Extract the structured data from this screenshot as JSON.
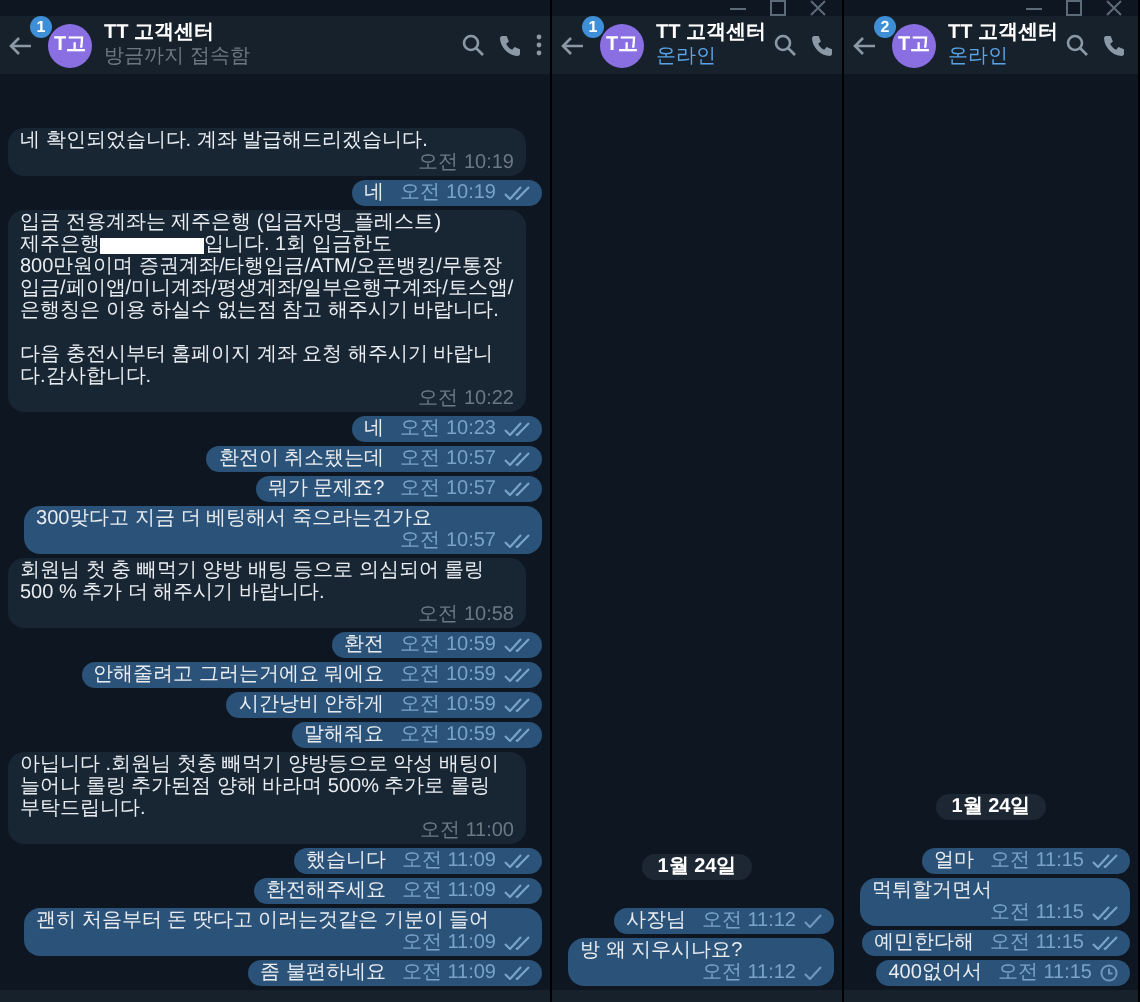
{
  "panes": [
    {
      "window_controls": false,
      "header": {
        "badge": "1",
        "avatar": "T고",
        "title": "TT 고객센터",
        "subtitle": "방금까지 접속함",
        "online": false
      },
      "messages": [
        {
          "kind": "message",
          "outgoing": false,
          "text": "네 확인되었습니다. 계좌 발급해드리겠습니다.",
          "time": "오전 10:19"
        },
        {
          "kind": "message",
          "outgoing": true,
          "text": "네",
          "time": "오전 10:19",
          "read": true,
          "pending": false
        },
        {
          "kind": "message",
          "outgoing": false,
          "parts": [
            {
              "kind": "line",
              "text": "입금 전용계좌는 제주은행 (입금자명_플레스트)"
            },
            {
              "kind": "text",
              "text": "제주은행"
            },
            {
              "kind": "redaction"
            },
            {
              "kind": "text",
              "text": "입니다. 1회 입금한도"
            },
            {
              "kind": "line",
              "text": "800만원이며 증권계좌/타행입금/ATM/오픈뱅킹/무통장입금/페이앱/미니계좌/평생계좌/일부은행구계좌/토스앱/은행칭은 이용 하실수 없는점 참고 해주시기 바랍니다.\n\n다음 충전시부터 홈페이지 계좌 요청 해주시기 바랍니다.감사합니다."
            }
          ],
          "time": "오전 10:22"
        },
        {
          "kind": "message",
          "outgoing": true,
          "text": "네",
          "time": "오전 10:23",
          "read": true,
          "pending": false
        },
        {
          "kind": "message",
          "outgoing": true,
          "text": "환전이 취소됐는데",
          "time": "오전 10:57",
          "read": true,
          "pending": false
        },
        {
          "kind": "message",
          "outgoing": true,
          "text": "뭐가 문제죠?",
          "time": "오전 10:57",
          "read": true,
          "pending": false
        },
        {
          "kind": "message",
          "outgoing": true,
          "text": "300맞다고 지금 더 베팅해서 죽으라는건가요",
          "time": "오전 10:57",
          "read": true,
          "pending": false
        },
        {
          "kind": "message",
          "outgoing": false,
          "text": "회원님 첫 충 빼먹기 양방 배팅 등으로 의심되어 롤링 500 % 추가 더 해주시기 바랍니다.",
          "time": "오전 10:58"
        },
        {
          "kind": "message",
          "outgoing": true,
          "text": "환전",
          "time": "오전 10:59",
          "read": true,
          "pending": false
        },
        {
          "kind": "message",
          "outgoing": true,
          "text": "안해줄려고 그러는거에요 뭐에요",
          "time": "오전 10:59",
          "read": true,
          "pending": false
        },
        {
          "kind": "message",
          "outgoing": true,
          "text": "시간낭비 안하게",
          "time": "오전 10:59",
          "read": true,
          "pending": false
        },
        {
          "kind": "message",
          "outgoing": true,
          "text": "말해줘요",
          "time": "오전 10:59",
          "read": true,
          "pending": false
        },
        {
          "kind": "message",
          "outgoing": false,
          "text": "아닙니다 .회원님 첫충 빼먹기 양방등으로 악성 배팅이 늘어나 롤링 추가된점 양해 바라며 500% 추가로 롤링 부탁드립니다.",
          "time": "오전 11:00"
        },
        {
          "kind": "message",
          "outgoing": true,
          "text": "했습니다",
          "time": "오전 11:09",
          "read": true,
          "pending": false
        },
        {
          "kind": "message",
          "outgoing": true,
          "text": "환전해주세요",
          "time": "오전 11:09",
          "read": true,
          "pending": false
        },
        {
          "kind": "message",
          "outgoing": true,
          "text": "괜히 처음부터 돈 땃다고 이러는것같은 기분이 들어",
          "time": "오전 11:09",
          "read": true,
          "pending": false
        },
        {
          "kind": "message",
          "outgoing": true,
          "text": "좀 불편하네요",
          "time": "오전 11:09",
          "read": true,
          "pending": false
        }
      ]
    },
    {
      "window_controls": true,
      "header": {
        "badge": "1",
        "avatar": "T고",
        "title": "TT 고객센터",
        "subtitle": "온라인",
        "online": true
      },
      "messages": [
        {
          "kind": "date",
          "text": "1월 24일"
        },
        {
          "kind": "message",
          "outgoing": true,
          "text": "사장님",
          "time": "오전 11:12",
          "read": false,
          "pending": false
        },
        {
          "kind": "message",
          "outgoing": true,
          "text": "방 왜 지우시나요?",
          "time": "오전 11:12",
          "read": false,
          "pending": false
        }
      ]
    },
    {
      "window_controls": true,
      "header": {
        "badge": "2",
        "avatar": "T고",
        "title": "TT 고객센터",
        "subtitle": "온라인",
        "online": true
      },
      "messages": [
        {
          "kind": "date",
          "text": "1월 24일"
        },
        {
          "kind": "message",
          "outgoing": true,
          "text": "얼마",
          "time": "오전 11:15",
          "read": true,
          "pending": false
        },
        {
          "kind": "message",
          "outgoing": true,
          "text": "먹튀할거면서",
          "time": "오전 11:15",
          "read": true,
          "pending": false
        },
        {
          "kind": "message",
          "outgoing": true,
          "text": "예민한다해",
          "time": "오전 11:15",
          "read": true,
          "pending": false
        },
        {
          "kind": "message",
          "outgoing": true,
          "text": "400없어서",
          "time": "오전 11:15",
          "read": false,
          "pending": true
        }
      ]
    }
  ]
}
